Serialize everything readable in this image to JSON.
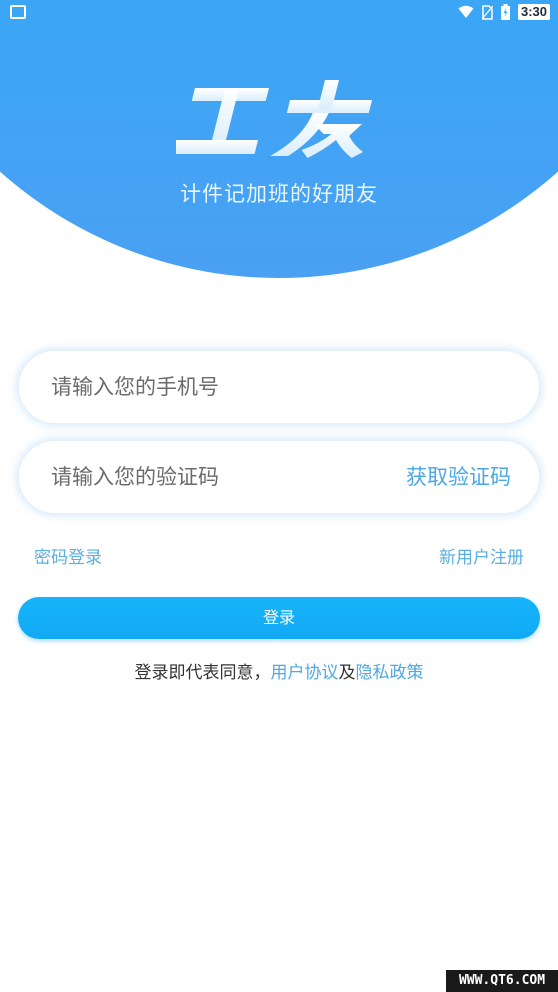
{
  "status_bar": {
    "time": "3:30"
  },
  "header": {
    "logo_text": "工友",
    "tagline": "计件记加班的好朋友"
  },
  "form": {
    "phone_placeholder": "请输入您的手机号",
    "code_placeholder": "请输入您的验证码",
    "get_code_label": "获取验证码",
    "password_login_label": "密码登录",
    "register_label": "新用户注册",
    "login_button_label": "登录"
  },
  "agreement": {
    "prefix": "登录即代表同意，",
    "user_agreement": "用户协议",
    "conjunction": "及",
    "privacy_policy": "隐私政策"
  },
  "watermark": "WWW.QT6.COM",
  "colors": {
    "brand_blue": "#2fb3fb",
    "link_blue": "#4fa8e0",
    "button_blue": "#16b4fb"
  }
}
